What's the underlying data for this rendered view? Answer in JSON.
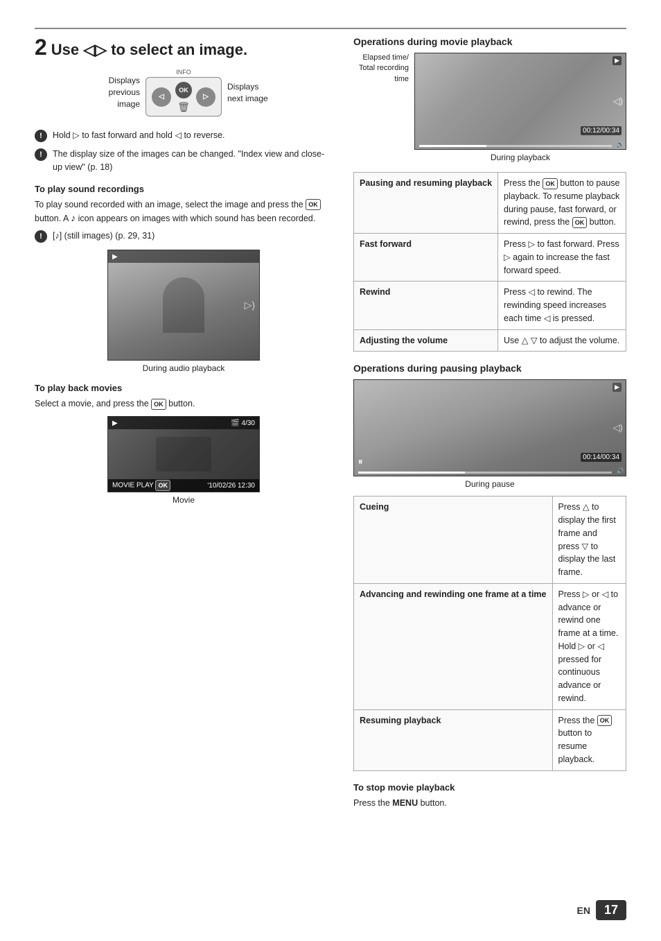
{
  "page": {
    "step_num": "2",
    "step_heading": "Use ◁▷ to select an image.",
    "left_col": {
      "nav_diagram": {
        "left_label_line1": "Displays",
        "left_label_line2": "previous",
        "left_label_line3": "image",
        "button_info": "INFO",
        "button_ok": "OK",
        "button_trash": "🗑",
        "right_label_line1": "Displays",
        "right_label_line2": "next image"
      },
      "bullets": [
        {
          "text": "Hold ▷ to fast forward and hold ◁ to reverse."
        },
        {
          "text": "The display size of the images can be changed. \"Index view and close-up view\" (p. 18)"
        }
      ],
      "sound_section": {
        "heading": "To play sound recordings",
        "body1": "To play sound recorded with an image, select the image and press the",
        "body1b": "button. A",
        "body2": "icon appears on images with which sound has been recorded.",
        "bullet": "[♪] (still images) (p. 29, 31)",
        "caption": "During audio playback"
      },
      "movie_section": {
        "heading": "To play back movies",
        "body": "Select a movie, and press the",
        "bodyb": "button.",
        "movie_top_left": "▶",
        "movie_top_right": "🎬 4/30",
        "movie_bottom_left": "MOVIE PLAY OK",
        "movie_bottom_right": "'10/02/26  12:30",
        "caption": "Movie"
      }
    },
    "right_col": {
      "ops_movie_heading": "Operations during movie playback",
      "elapsed_label_line1": "Elapsed time/",
      "elapsed_label_line2": "Total recording",
      "elapsed_label_line3": "time",
      "timecode_movie": "00:12/00:34",
      "during_playback_caption": "During playback",
      "movie_table": [
        {
          "term": "Pausing and resuming playback",
          "def": "Press the OK button to pause playback. To resume playback during pause, fast forward, or rewind, press the OK button."
        },
        {
          "term": "Fast forward",
          "def": "Press ▷ to fast forward. Press ▷ again to increase the fast forward speed."
        },
        {
          "term": "Rewind",
          "def": "Press ◁ to rewind. The rewinding speed increases each time ◁ is pressed."
        },
        {
          "term": "Adjusting the volume",
          "def": "Use △ ▽ to adjust the volume."
        }
      ],
      "ops_pause_heading": "Operations during pausing playback",
      "timecode_pause": "00:14/00:34",
      "during_pause_caption": "During pause",
      "pause_table": [
        {
          "term": "Cueing",
          "def": "Press △ to display the first frame and press ▽ to display the last frame."
        },
        {
          "term": "Advancing and rewinding one frame at a time",
          "def": "Press ▷ or ◁ to advance or rewind one frame at a time. Hold ▷ or ◁ pressed for continuous advance or rewind."
        },
        {
          "term": "Resuming playback",
          "def": "Press the OK button to resume playback."
        }
      ],
      "stop_heading": "To stop movie playback",
      "stop_body": "Press the",
      "stop_menu": "MENU",
      "stop_body2": "button."
    },
    "footer": {
      "en_label": "EN",
      "page_number": "17"
    }
  }
}
